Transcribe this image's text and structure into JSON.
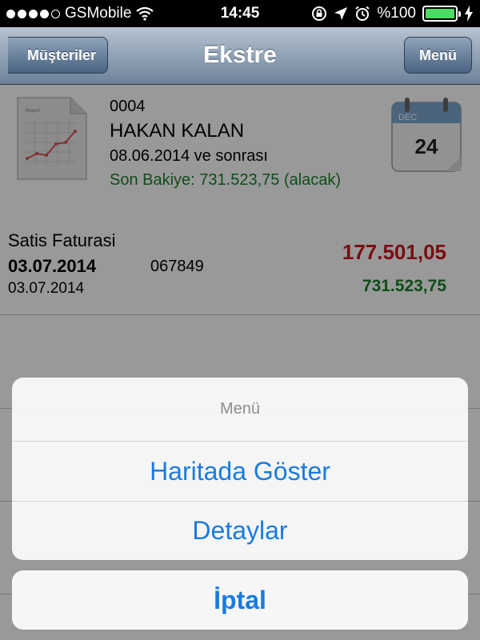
{
  "status_bar": {
    "carrier": "GSMobile",
    "time": "14:45",
    "battery_text": "%100",
    "signal_bars_filled": 4,
    "signal_bars_total": 5
  },
  "nav": {
    "back_label": "Müşteriler",
    "title": "Ekstre",
    "menu_label": "Menü"
  },
  "customer": {
    "code": "0004",
    "name": "HAKAN KALAN",
    "date_range": "08.06.2014 ve sonrası",
    "balance_line": "Son Bakiye: 731.523,75 (alacak)",
    "calendar_month": "DEC",
    "calendar_day": "24",
    "report_icon_label": "Report"
  },
  "transactions": [
    {
      "type": "Satis Faturasi",
      "date_bold": "03.07.2014",
      "doc_no": "067849",
      "date": "03.07.2014",
      "amount": "177.501,05",
      "balance": "731.523,75"
    }
  ],
  "action_sheet": {
    "title": "Menü",
    "items": [
      "Haritada Göster",
      "Detaylar"
    ],
    "cancel": "İptal"
  },
  "colors": {
    "amount_red": "#c8161d",
    "balance_green": "#1a7f2a",
    "ios_blue": "#1a7be0",
    "battery_green": "#4cd964"
  }
}
